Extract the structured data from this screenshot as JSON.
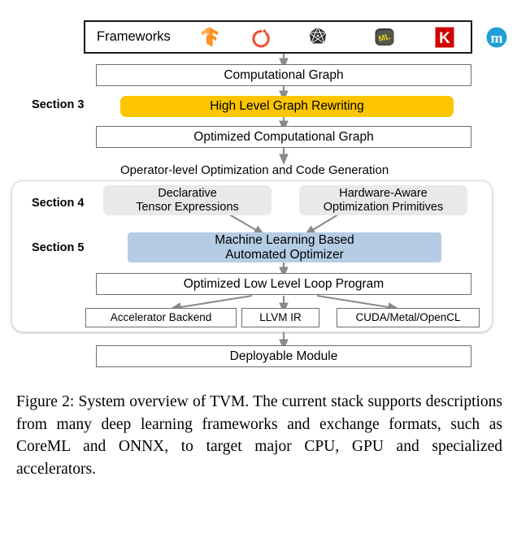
{
  "figure": {
    "frameworks_row": {
      "label": "Frameworks",
      "logos": [
        {
          "name": "tensorflow-logo",
          "alt": "TensorFlow",
          "color": "#ff8f1c"
        },
        {
          "name": "pytorch-logo",
          "alt": "PyTorch",
          "color": "#ee4c2c"
        },
        {
          "name": "onnx-logo",
          "alt": "ONNX",
          "color": "#2b2b2b"
        },
        {
          "name": "coreml-logo",
          "alt": "CoreML",
          "color": "#3a3a32"
        },
        {
          "name": "keras-logo",
          "alt": "Keras",
          "color": "#d00000",
          "glyph": "K"
        },
        {
          "name": "mxnet-logo",
          "alt": "MXNet",
          "color": "#1e9fd8",
          "glyph": "m"
        }
      ]
    },
    "nodes": {
      "computational_graph": "Computational Graph",
      "high_level_graph_rewriting": "High Level Graph Rewriting",
      "optimized_computational_graph": "Optimized Computational Graph",
      "operator_level_heading": "Operator-level Optimization and Code Generation",
      "declarative_tensor_expressions": "Declarative\nTensor Expressions",
      "hardware_aware_optimization_primitives": "Hardware-Aware\nOptimization Primitives",
      "ml_based_automated_optimizer": "Machine Learning Based\nAutomated Optimizer",
      "optimized_low_level_loop_program": "Optimized Low Level Loop Program",
      "accelerator_backend": "Accelerator Backend",
      "llvm_ir": "LLVM IR",
      "cuda_metal_opencl": "CUDA/Metal/OpenCL",
      "deployable_module": "Deployable Module"
    },
    "section_labels": {
      "section3": "Section 3",
      "section4": "Section 4",
      "section5": "Section 5"
    },
    "colors": {
      "highlight_yellow": "#fdc500",
      "highlight_blue": "#b4cde4",
      "highlight_gray": "#e9e9e9",
      "arrow_gray": "#8a8a8a",
      "box_border": "#6e6e6e"
    }
  },
  "caption": {
    "figure_label": "Figure 2:",
    "text": "System overview of TVM. The current stack supports descriptions from many deep learning frameworks and exchange formats, such as CoreML and ONNX, to target major CPU, GPU and specialized accelerators."
  }
}
